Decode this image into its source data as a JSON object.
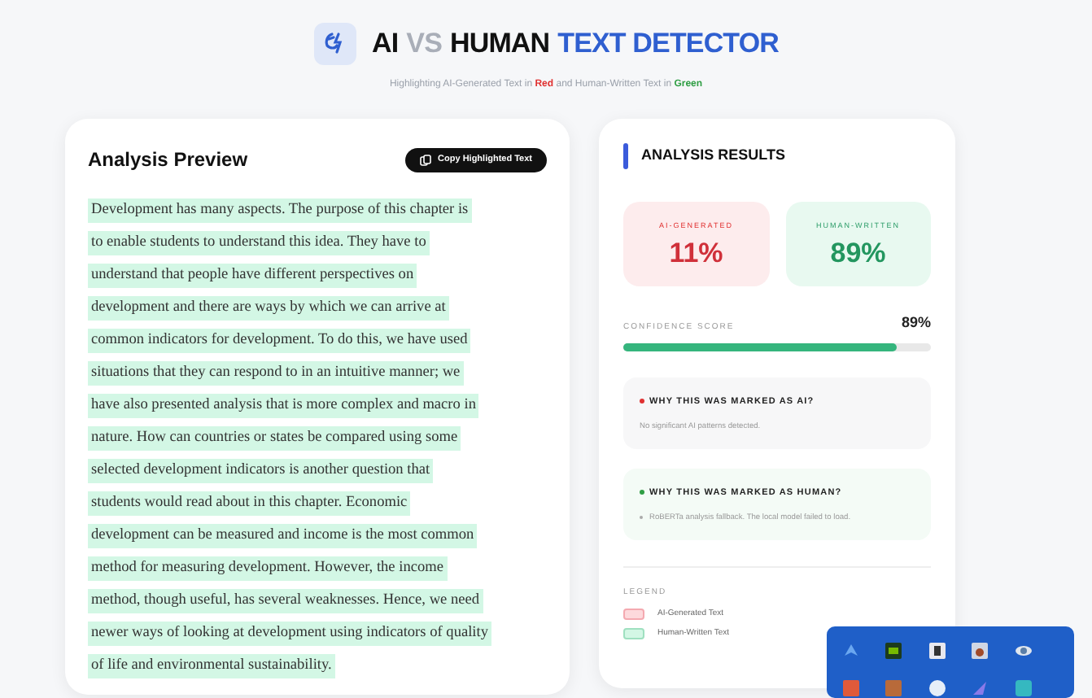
{
  "header": {
    "title_parts": [
      {
        "text": "AI",
        "kind": "dark"
      },
      {
        "text": "VS",
        "kind": "faint"
      },
      {
        "text": "HUMAN",
        "kind": "dark"
      },
      {
        "text": "TEXT DETECTOR",
        "kind": "accent"
      }
    ],
    "subtitle": "Highlighting AI-Generated Text in **Red** and Human-Written Text in **Green**"
  },
  "preview": {
    "title": "Analysis Preview",
    "copy_button": "Copy Highlighted Text",
    "segments": [
      {
        "kind": "human",
        "text": "Development has many aspects. The purpose of this chapter is"
      },
      {
        "kind": "human",
        "text": "to enable students to understand this idea. They have to"
      },
      {
        "kind": "human",
        "text": "understand that people have different perspectives on"
      },
      {
        "kind": "human",
        "text": "development and there are ways by which we can arrive at"
      },
      {
        "kind": "human",
        "text": "common indicators for development. To do this, we have used"
      },
      {
        "kind": "human",
        "text": "situations that they can respond to in an intuitive manner; we"
      },
      {
        "kind": "human",
        "text": "have also presented analysis that is more complex and macro in"
      },
      {
        "kind": "human",
        "text": "nature. How can countries or states be compared using some"
      },
      {
        "kind": "human",
        "text": "selected development indicators is another question that"
      },
      {
        "kind": "human",
        "text": "students would read about in this chapter. Economic"
      },
      {
        "kind": "human",
        "text": "development can be measured and income is the most common"
      },
      {
        "kind": "human",
        "text": "method for measuring development. However, the income"
      },
      {
        "kind": "human",
        "text": "method, though useful, has several weaknesses. Hence, we need"
      },
      {
        "kind": "human",
        "text": "newer ways of looking at development using indicators of quality"
      },
      {
        "kind": "human",
        "text": "of life and environmental sustainability."
      }
    ]
  },
  "results": {
    "title": "ANALYSIS RESULTS",
    "scores": [
      {
        "kind": "ai",
        "label": "AI-GENERATED",
        "value": "11%"
      },
      {
        "kind": "human",
        "label": "HUMAN-WRITTEN",
        "value": "89%"
      }
    ],
    "confidence": {
      "label": "CONFIDENCE SCORE",
      "reading": "89%",
      "level": 0.89
    },
    "reasons": [
      {
        "kind": "ai",
        "title": "WHY THIS WAS MARKED AS AI?",
        "text": "No significant AI patterns detected.",
        "bullet": false
      },
      {
        "kind": "human",
        "title": "WHY THIS WAS MARKED AS HUMAN?",
        "text": "RoBERTa analysis fallback. The local model failed to load.",
        "bullet": true
      }
    ],
    "legend": {
      "title": "LEGEND",
      "items": [
        {
          "kind": "ai",
          "label": "AI-Generated Text"
        },
        {
          "kind": "human",
          "label": "Human-Written Text"
        }
      ]
    }
  }
}
